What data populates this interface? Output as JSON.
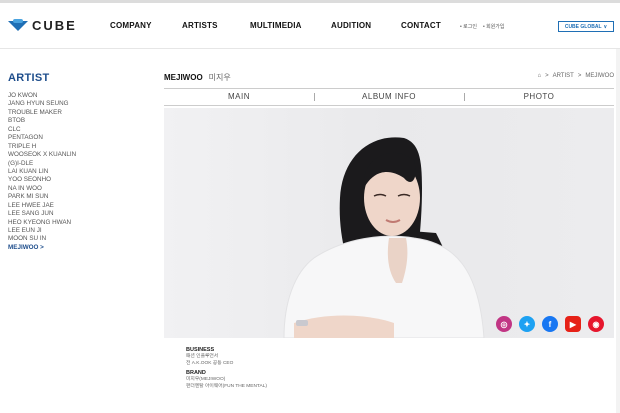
{
  "header": {
    "logo_text": "CUBE",
    "nav": [
      "COMPANY",
      "ARTISTS",
      "MULTIMEDIA",
      "AUDITION",
      "CONTACT"
    ],
    "util": [
      "• 로그인",
      "• 회원가입"
    ],
    "global_label": "CUBE GLOBAL",
    "global_chevron": "∨"
  },
  "sidebar": {
    "title": "ARTIST",
    "items": [
      "JO KWON",
      "JANG HYUN SEUNG",
      "TROUBLE MAKER",
      "BTOB",
      "CLC",
      "PENTAGON",
      "TRIPLE H",
      "WOOSEOK X KUANLIN",
      "(G)I-DLE",
      "LAI KUAN LIN",
      "YOO SEONHO",
      "NA IN WOO",
      "PARK MI SUN",
      "LEE HWEE JAE",
      "LEE SANG JUN",
      "HEO KYEONG HWAN",
      "LEE EUN JI",
      "MOON SU IN",
      "MEJIWOO  >"
    ],
    "active_index": 18
  },
  "page": {
    "title": "MEJIWOO",
    "title_kr": "미지우",
    "breadcrumb": [
      "⌂",
      ">",
      "ARTIST",
      ">",
      "MEJIWOO"
    ]
  },
  "tabs": [
    "MAIN",
    "ALBUM INFO",
    "PHOTO"
  ],
  "social": [
    {
      "name": "instagram-icon",
      "color": "#c13584",
      "glyph": "◎"
    },
    {
      "name": "twitter-icon",
      "color": "#1da1f2",
      "glyph": "✦"
    },
    {
      "name": "facebook-icon",
      "color": "#1877f2",
      "glyph": "f"
    },
    {
      "name": "youtube-icon",
      "color": "#e62117",
      "glyph": "▶"
    },
    {
      "name": "weibo-icon",
      "color": "#e6162d",
      "glyph": "◉"
    }
  ],
  "info": {
    "business_title": "BUSINESS",
    "business_lines": [
      "패션 인플루언서",
      "전 A.K.OOK 공동 CEO"
    ],
    "brand_title": "BRAND",
    "brand_lines": [
      "미지우(MEJIWOO)",
      "펀더멘탈 아이웨어(FUN THE MENTAL)"
    ]
  }
}
